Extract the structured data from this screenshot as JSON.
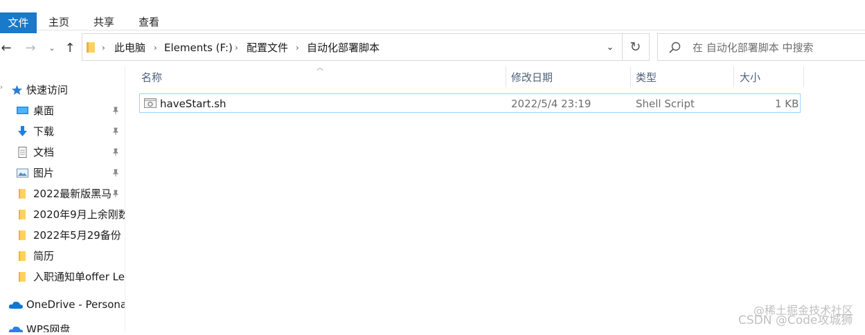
{
  "ribbon": {
    "tabs": [
      "文件",
      "主页",
      "共享",
      "查看"
    ]
  },
  "nav": {
    "back_icon": "←",
    "forward_icon": "→",
    "recent_icon": "⌄",
    "up_icon": "↑"
  },
  "address": {
    "segments": [
      "此电脑",
      "Elements (F:)",
      "配置文件",
      "自动化部署脚本"
    ],
    "separator": "›",
    "dropdown_icon": "⌄",
    "refresh_icon": "↻"
  },
  "search": {
    "placeholder": "在 自动化部署脚本 中搜索"
  },
  "sidebar": {
    "items": [
      {
        "label": "快速访问",
        "icon": "star-icon"
      },
      {
        "label": "桌面",
        "icon": "desktop-icon",
        "pinned": true
      },
      {
        "label": "下载",
        "icon": "download-icon",
        "pinned": true
      },
      {
        "label": "文档",
        "icon": "document-icon",
        "pinned": true
      },
      {
        "label": "图片",
        "icon": "picture-icon",
        "pinned": true
      },
      {
        "label": "2022最新版黑马",
        "icon": "folder-icon",
        "pinned": true
      },
      {
        "label": "2020年9月上余刚数",
        "icon": "folder-icon"
      },
      {
        "label": "2022年5月29备份",
        "icon": "folder-icon"
      },
      {
        "label": "简历",
        "icon": "folder-icon"
      },
      {
        "label": "入职通知单offer Le",
        "icon": "folder-icon"
      },
      {
        "label": "OneDrive - Persona",
        "icon": "cloud-icon"
      },
      {
        "label": "WPS网盘",
        "icon": "wps-cloud-icon"
      }
    ]
  },
  "columns": {
    "name": "名称",
    "modified": "修改日期",
    "type": "类型",
    "size": "大小"
  },
  "files": [
    {
      "name": "haveStart.sh",
      "modified": "2022/5/4 23:19",
      "type": "Shell Script",
      "size": "1 KB"
    }
  ],
  "watermark": {
    "line1": "@稀土掘金技术社区",
    "line2": "CSDN @Code攻城狮"
  },
  "colors": {
    "accent": "#1979ca",
    "selection_border": "#99d1ff",
    "header_text": "#4c607a"
  }
}
